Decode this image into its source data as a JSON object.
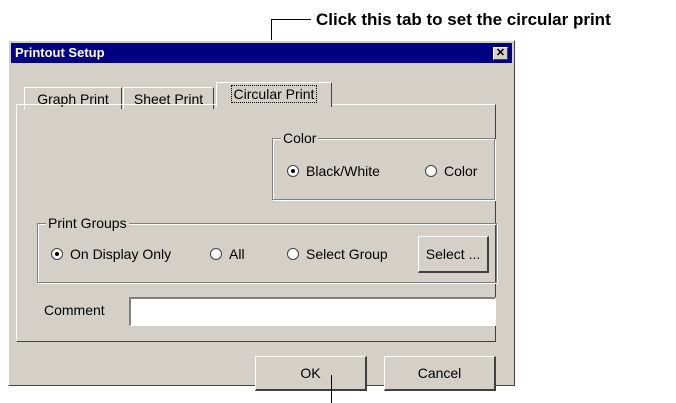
{
  "annotation": {
    "text": "Click this tab to set the circular print"
  },
  "window": {
    "title": "Printout Setup",
    "close_glyph": "✕"
  },
  "tabs": [
    {
      "label": "Graph Print",
      "active": false
    },
    {
      "label": "Sheet Print",
      "active": false
    },
    {
      "label": "Circular Print",
      "active": true
    }
  ],
  "color_group": {
    "label": "Color",
    "options": [
      {
        "label": "Black/White",
        "selected": true
      },
      {
        "label": "Color",
        "selected": false
      }
    ]
  },
  "print_groups": {
    "label": "Print Groups",
    "options": [
      {
        "label": "On Display Only",
        "selected": true
      },
      {
        "label": "All",
        "selected": false
      },
      {
        "label": "Select Group",
        "selected": false
      }
    ],
    "select_button": "Select ..."
  },
  "comment": {
    "label": "Comment",
    "value": ""
  },
  "buttons": {
    "ok": "OK",
    "cancel": "Cancel"
  }
}
